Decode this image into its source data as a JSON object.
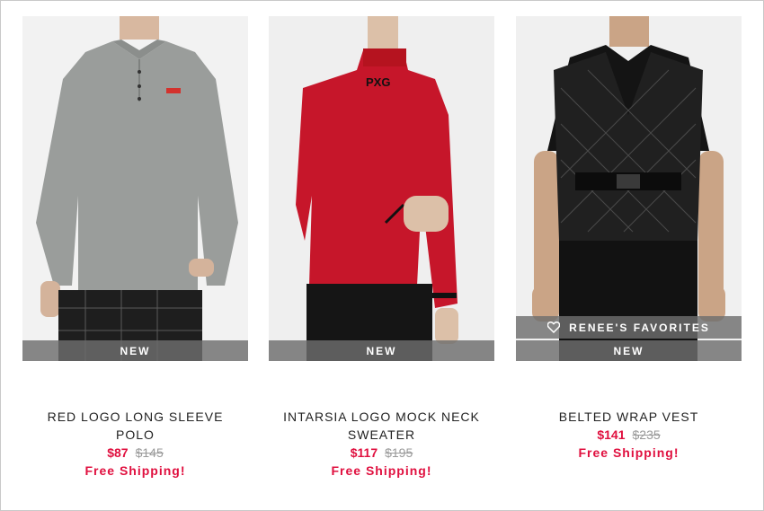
{
  "products": [
    {
      "badge": "NEW",
      "name": "RED LOGO LONG SLEEVE POLO",
      "sale_price": "$87",
      "original_price": "$145",
      "shipping": "Free Shipping!"
    },
    {
      "badge": "NEW",
      "name": "INTARSIA LOGO MOCK NECK SWEATER",
      "sale_price": "$117",
      "original_price": "$195",
      "shipping": "Free Shipping!"
    },
    {
      "badge": "NEW",
      "favorites_label": "RENEE'S FAVORITES",
      "name": "BELTED WRAP VEST",
      "sale_price": "$141",
      "original_price": "$235",
      "shipping": "Free Shipping!"
    }
  ],
  "colors": {
    "accent": "#e0103f",
    "strike": "#9a9a9a",
    "badge_bg": "#6e6e6e"
  },
  "icons": {
    "favorites": "heart-icon"
  }
}
